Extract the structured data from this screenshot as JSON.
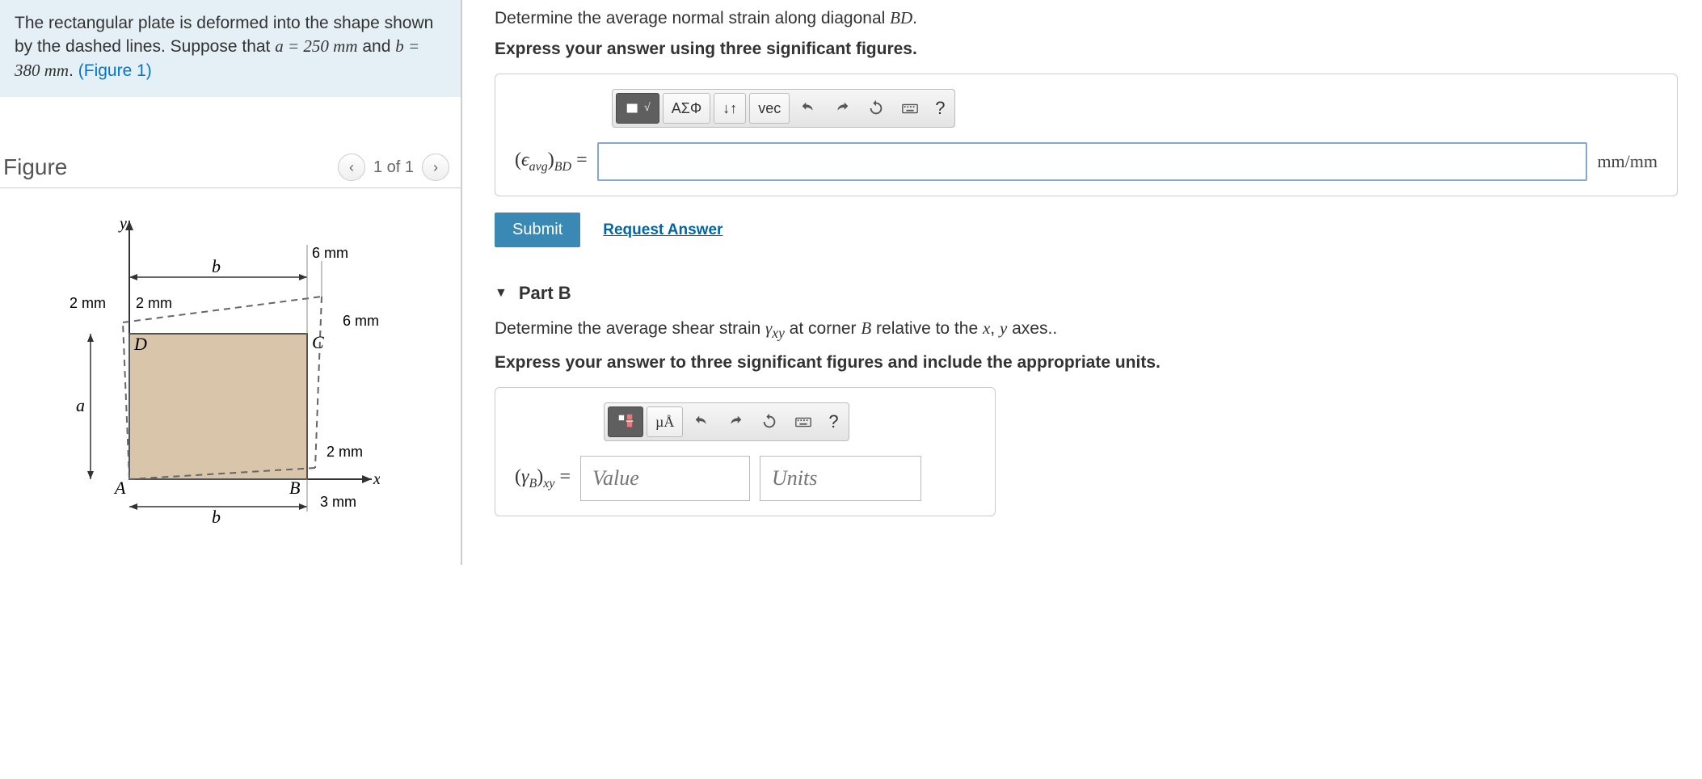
{
  "problem": {
    "text_1": "The rectangular plate is deformed into the shape shown by the dashed lines. Suppose that ",
    "param_a": "a = 250 mm",
    "text_2": " and ",
    "param_b": "b = 380 mm",
    "text_3": ". ",
    "fig_link": "(Figure 1)"
  },
  "figure": {
    "title": "Figure",
    "page": "1 of 1",
    "labels": {
      "y": "y",
      "x": "x",
      "A": "A",
      "B": "B",
      "C": "C",
      "D": "D",
      "a": "a",
      "b_top": "b",
      "b_bottom": "b",
      "d_2mm_left": "2 mm",
      "d_2mm_top": "2 mm",
      "d_6mm_top": "6 mm",
      "d_6mm_right": "6 mm",
      "d_2mm_right": "2 mm",
      "d_3mm": "3 mm"
    }
  },
  "partA": {
    "prompt_1": "Determine the average normal strain along diagonal ",
    "prompt_math": "BD",
    "prompt_2": ".",
    "hint": "Express your answer using three significant figures.",
    "label": "(ϵavg)BD =",
    "unit": "mm/mm",
    "submit": "Submit",
    "request": "Request Answer",
    "toolbar": {
      "greek": "ΑΣΦ",
      "vec": "vec",
      "help": "?"
    }
  },
  "partB": {
    "title": "Part B",
    "prompt": "Determine the average shear strain γxy at corner B relative to the x, y axes..",
    "hint": "Express your answer to three significant figures and include the appropriate units.",
    "label": "(γB)xy =",
    "value_ph": "Value",
    "units_ph": "Units",
    "toolbar": {
      "ua": "µÅ",
      "help": "?"
    }
  }
}
